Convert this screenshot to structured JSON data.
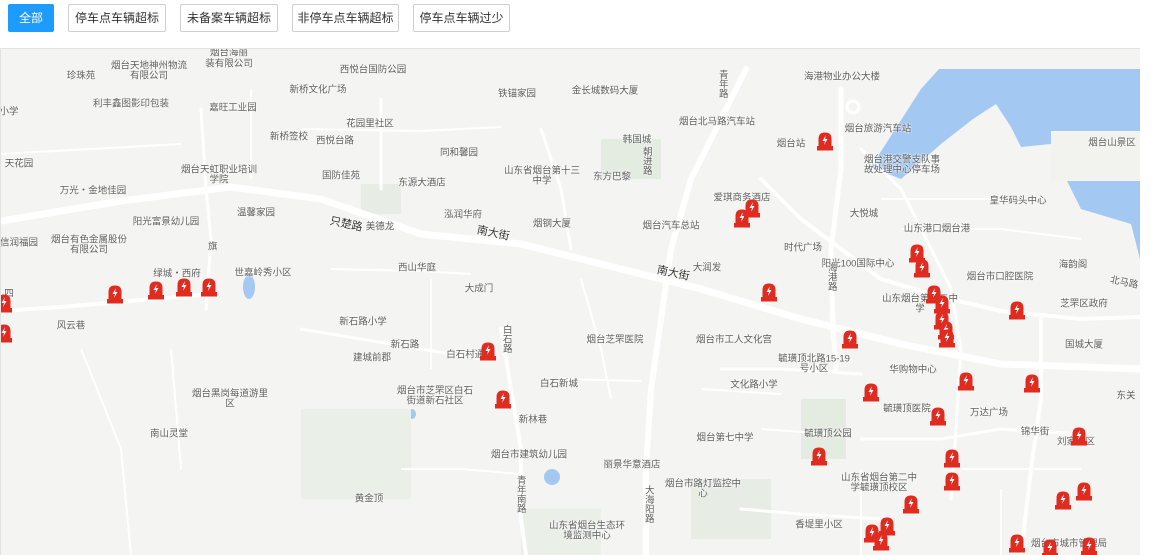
{
  "filters": {
    "items": [
      {
        "label": "全部",
        "active": true
      },
      {
        "label": "停车点车辆超标",
        "active": false
      },
      {
        "label": "未备案车辆超标",
        "active": false
      },
      {
        "label": "非停车点车辆超标",
        "active": false
      },
      {
        "label": "停车点车辆过少",
        "active": false
      }
    ]
  },
  "map": {
    "colors": {
      "background": "#f4f4f2",
      "water": "#a3c8f2",
      "marker": "#e02b20",
      "road": "#ffffff"
    },
    "marker_icon": "parking-alert-marker-icon",
    "labels": [
      "珍珠苑",
      "小学",
      "利丰鑫图影印包装",
      "天花园",
      "万光・金地佳园",
      "信润福园",
      "旗",
      "四",
      "风云巷",
      "烟台天地神州物流有限公司",
      "烟台海丽",
      "装有限公司",
      "嘉旺工业园",
      "西悦台国防公园",
      "新桥文化广场",
      "新桥签校",
      "花园里社区",
      "西悦台路",
      "烟台天虹职业培训学院",
      "国防佳苑",
      "温馨家园",
      "阳光富景幼儿园",
      "烟台有色金属股份有限公司",
      "绿城・西府",
      "世嘉岭秀小区",
      "只楚路",
      "美德龙",
      "同和馨园",
      "东源大酒店",
      "泓润华府",
      "铁锚家园",
      "金长城数码大厦",
      "山东省烟台第十三中学",
      "东方巴黎",
      "烟钢大厦",
      "南大街",
      "西山华庭",
      "大成门",
      "新石路小学",
      "新石路",
      "建城前郡",
      "白石村通社",
      "白石路",
      "白石新城",
      "烟台市芝罘区白石街道新石社区",
      "新林巷",
      "烟台黑岗每道游里区",
      "南山灵堂",
      "黄金顶",
      "烟台市建筑幼儿园",
      "青年南路",
      "烟台北马路汽车站",
      "韩国城",
      "朝进路",
      "烟台站",
      "烟台汽车总站",
      "爱琪商务酒店",
      "南大街",
      "大润发",
      "时代广场",
      "烟台芝罘医院",
      "烟台市工人文化宫",
      "文化路小学",
      "烟台第七中学",
      "丽景华意酒店",
      "烟台市路灯监控中心",
      "山东省烟台生态环境监测中心",
      "大海阳路",
      "青年路",
      "海港物业办公大楼",
      "烟台旅游汽车站",
      "烟台港交警支队事故处理中心停车场",
      "烟台山景区",
      "大悦城",
      "山东港口烟台港",
      "阳光100国际中心",
      "海港路",
      "山东烟台第十二中学",
      "烟台市口腔医院",
      "海韵阁",
      "北马路",
      "芝罘区政府",
      "国城大厦",
      "皇华码头中心",
      "毓璜顶北路15-19号小区",
      "华购物中心",
      "毓璜顶医院",
      "万达广场",
      "毓璜顶公园",
      "锦华街",
      "东关",
      "刘家小区",
      "山东省烟台第二中学毓璜顶校区",
      "香堤里小区",
      "烟台市城市管理局"
    ],
    "markers_count": 44
  }
}
